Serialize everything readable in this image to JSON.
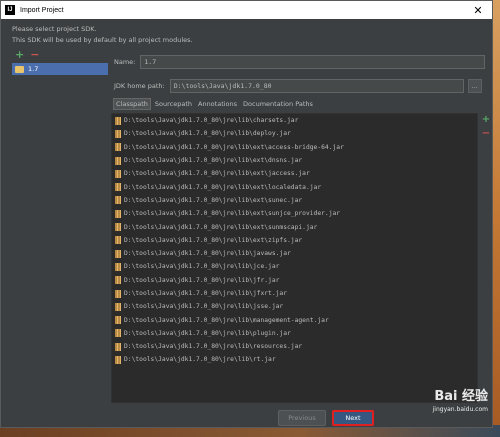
{
  "window": {
    "title": "Import Project",
    "icon_letter": "IJ",
    "close_glyph": "✕"
  },
  "intro": {
    "line1": "Please select project SDK.",
    "line2": "This SDK will be used by default by all project modules."
  },
  "sdk_list": {
    "add_glyph": "+",
    "remove_glyph": "−",
    "items": [
      {
        "label": "1.7"
      }
    ]
  },
  "form": {
    "name_label": "Name:",
    "name_value": "1.7",
    "jdk_home_label": "JDK home path:",
    "jdk_home_value": "D:\\tools\\Java\\jdk1.7.0_80",
    "browse_glyph": "…"
  },
  "tabs": [
    {
      "label": "Classpath",
      "active": true
    },
    {
      "label": "Sourcepath",
      "active": false
    },
    {
      "label": "Annotations",
      "active": false
    },
    {
      "label": "Documentation Paths",
      "active": false
    }
  ],
  "classpath": [
    "D:\\tools\\Java\\jdk1.7.0_80\\jre\\lib\\charsets.jar",
    "D:\\tools\\Java\\jdk1.7.0_80\\jre\\lib\\deploy.jar",
    "D:\\tools\\Java\\jdk1.7.0_80\\jre\\lib\\ext\\access-bridge-64.jar",
    "D:\\tools\\Java\\jdk1.7.0_80\\jre\\lib\\ext\\dnsns.jar",
    "D:\\tools\\Java\\jdk1.7.0_80\\jre\\lib\\ext\\jaccess.jar",
    "D:\\tools\\Java\\jdk1.7.0_80\\jre\\lib\\ext\\localedata.jar",
    "D:\\tools\\Java\\jdk1.7.0_80\\jre\\lib\\ext\\sunec.jar",
    "D:\\tools\\Java\\jdk1.7.0_80\\jre\\lib\\ext\\sunjce_provider.jar",
    "D:\\tools\\Java\\jdk1.7.0_80\\jre\\lib\\ext\\sunmscapi.jar",
    "D:\\tools\\Java\\jdk1.7.0_80\\jre\\lib\\ext\\zipfs.jar",
    "D:\\tools\\Java\\jdk1.7.0_80\\jre\\lib\\javaws.jar",
    "D:\\tools\\Java\\jdk1.7.0_80\\jre\\lib\\jce.jar",
    "D:\\tools\\Java\\jdk1.7.0_80\\jre\\lib\\jfr.jar",
    "D:\\tools\\Java\\jdk1.7.0_80\\jre\\lib\\jfxrt.jar",
    "D:\\tools\\Java\\jdk1.7.0_80\\jre\\lib\\jsse.jar",
    "D:\\tools\\Java\\jdk1.7.0_80\\jre\\lib\\management-agent.jar",
    "D:\\tools\\Java\\jdk1.7.0_80\\jre\\lib\\plugin.jar",
    "D:\\tools\\Java\\jdk1.7.0_80\\jre\\lib\\resources.jar",
    "D:\\tools\\Java\\jdk1.7.0_80\\jre\\lib\\rt.jar"
  ],
  "side_tools": {
    "add_glyph": "+",
    "remove_glyph": "−"
  },
  "buttons": {
    "previous": "Previous",
    "next": "Next"
  },
  "watermark": {
    "brand": "Bai 经验",
    "url": "jingyan.baidu.com"
  },
  "colors": {
    "dialog_bg": "#3c3f41",
    "selection": "#4b6eaf",
    "next_highlight": "#e02020"
  }
}
